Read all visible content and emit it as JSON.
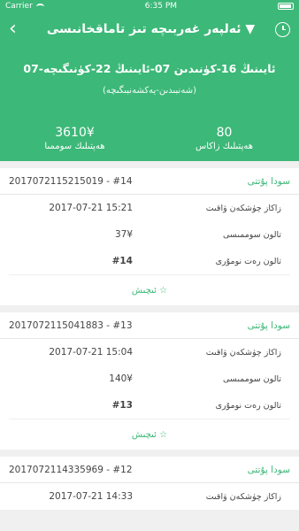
{
  "status_bar": {
    "carrier": "Carrier",
    "time": "6:35 PM"
  },
  "header": {
    "title": "ئەلپەر غەربىچە تىز تاماقخانىسى ▼",
    "date_range": "07-ئايىنىڭ 16-كۈنىدىن  07-ئايىنىڭ 22-كۈنىگىچە",
    "date_sub": "(شەنبىدىن-يەكشەنبىگىچە)",
    "stats": [
      {
        "value": "3610¥",
        "label": "ھەپتىلىك سوممىا"
      },
      {
        "value": "80",
        "label": "ھەپتىلىك زاكاس"
      }
    ]
  },
  "orders": [
    {
      "type": "سودا پۇتتى",
      "number": "2017072115215019 - #14",
      "rows": [
        {
          "label": "زاكاز چۈشكەن ۋاقىت",
          "value": "2017-07-21 15:21"
        },
        {
          "label": "تالون سوممىسى",
          "value": "37¥"
        },
        {
          "label": "تالون رەت نومۇرى",
          "value": "#14"
        }
      ],
      "more": "ئىچىش ☆"
    },
    {
      "type": "سودا پۇتتى",
      "number": "2017072115041883 - #13",
      "rows": [
        {
          "label": "زاكاز چۈشكەن ۋاقىت",
          "value": "2017-07-21 15:04"
        },
        {
          "label": "تالون سوممىسى",
          "value": "140¥"
        },
        {
          "label": "تالون رەت نومۇرى",
          "value": "#13"
        }
      ],
      "more": "ئىچىش ☆"
    },
    {
      "type": "سودا پۇتتى",
      "number": "2017072114335969 - #12",
      "rows": [
        {
          "label": "زاكاز چۈشكەن ۋاقىت",
          "value": "2017-07-21 14:33"
        }
      ]
    }
  ]
}
